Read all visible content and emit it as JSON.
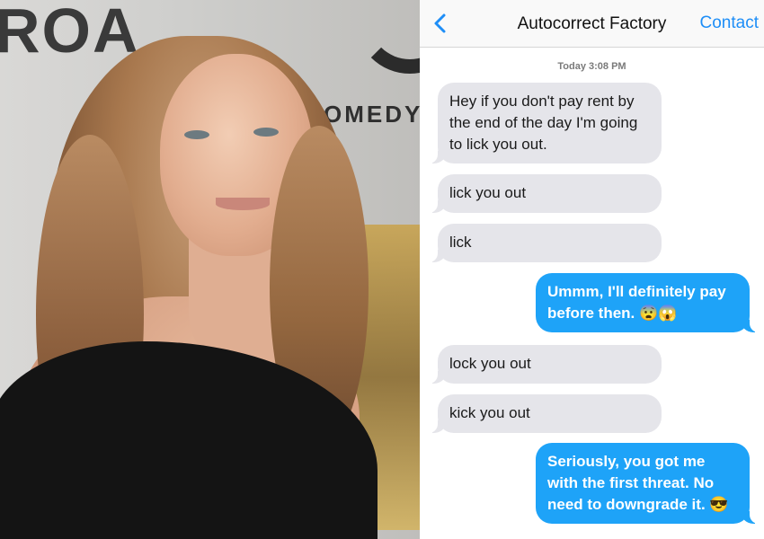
{
  "backdrop": {
    "text_top": "ROA",
    "text_comedy": "OMEDY"
  },
  "header": {
    "title": "Autocorrect Factory",
    "contact_label": "Contact",
    "back_icon": "chevron-left-icon",
    "accent": "#1e8ef7"
  },
  "timestamp": "Today 3:08 PM",
  "messages": [
    {
      "from": "them",
      "text": "Hey if you don't pay rent by the end of the day I'm going to lick you out."
    },
    {
      "from": "them",
      "text": "lick you out"
    },
    {
      "from": "them",
      "text": "lick"
    },
    {
      "from": "me",
      "text": "Ummm, I'll definitely pay before then. 😨😱"
    },
    {
      "from": "them",
      "text": "lock you out"
    },
    {
      "from": "them",
      "text": "kick you out"
    },
    {
      "from": "me",
      "text": "Seriously, you got me with the first threat. No need to downgrade it. 😎"
    }
  ],
  "colors": {
    "incoming_bubble": "#e5e5ea",
    "outgoing_bubble": "#1ea3f8"
  }
}
